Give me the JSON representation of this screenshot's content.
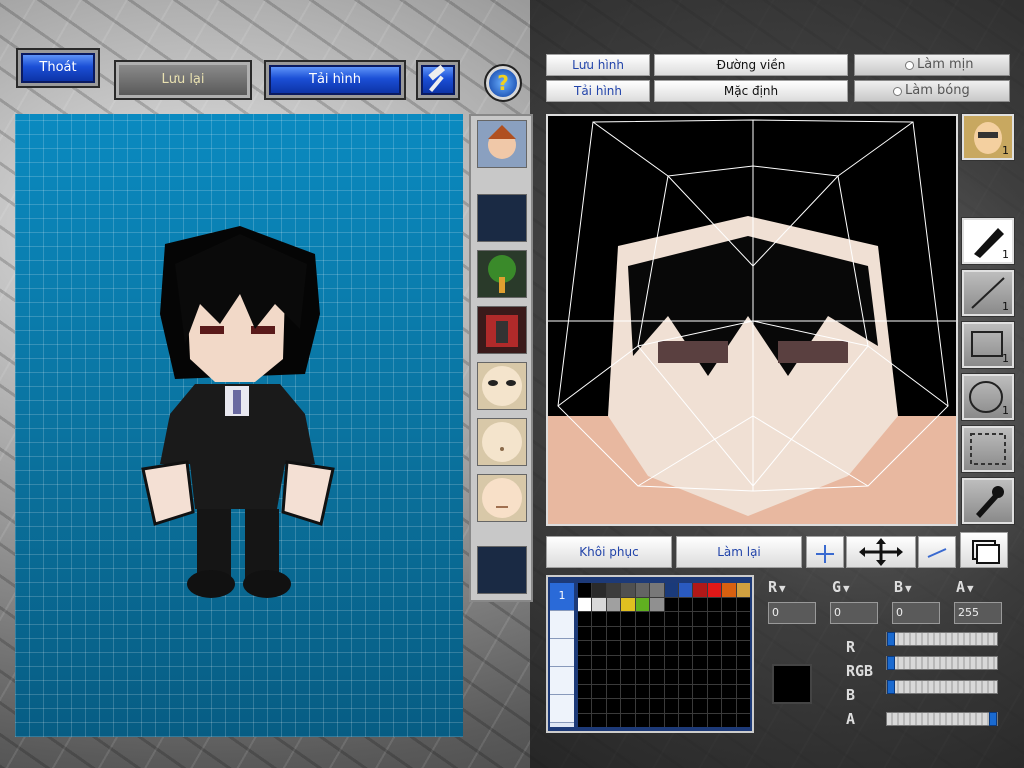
{
  "toolbar": {
    "exit_label": "Thoát",
    "save_label": "Lưu lại",
    "reload_label": "Tải hình",
    "help_label": "?"
  },
  "editor_header": {
    "save_image": "Lưu hình",
    "load_image": "Tải hình",
    "outline": "Đường viền",
    "default": "Mặc định",
    "smooth": "Làm mịn",
    "shade": "Làm bóng"
  },
  "tools": {
    "pen_count": "1",
    "line_count": "1",
    "rect_count": "1",
    "ellipse_count": "1",
    "portrait_count": "1"
  },
  "actions": {
    "restore": "Khôi phục",
    "redo": "Làm lại"
  },
  "color": {
    "r_value": "0",
    "g_value": "0",
    "b_value": "0",
    "a_value": "255",
    "r_label": "R",
    "g_label": "G",
    "b_label": "B",
    "a_label": "A",
    "current": "#000000"
  },
  "palette": {
    "page_label": "1",
    "swatches": [
      "#000000",
      "#2a2a2a",
      "#3c3c3c",
      "#505050",
      "#646464",
      "#787878",
      "#1a3a7a",
      "#2a5ac0",
      "#b01818",
      "#e01818",
      "#d86010",
      "#d0a040",
      "#ffffff",
      "#d8d8d8",
      "#a0a0a0",
      "#e0c020",
      "#60b020",
      "#909090"
    ]
  }
}
